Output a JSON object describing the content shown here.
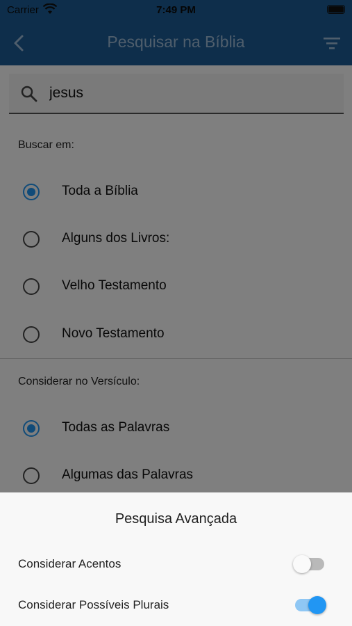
{
  "status_bar": {
    "carrier": "Carrier",
    "time": "7:49 PM"
  },
  "app_bar": {
    "title": "Pesquisar na Bíblia",
    "back_icon": "chevron-left-icon",
    "filter_icon": "filter-icon"
  },
  "search": {
    "value": "jesus",
    "icon": "search-icon"
  },
  "scope": {
    "label": "Buscar em:",
    "options": [
      {
        "label": "Toda a Bíblia",
        "selected": true
      },
      {
        "label": "Alguns dos Livros:",
        "selected": false
      },
      {
        "label": "Velho Testamento",
        "selected": false
      },
      {
        "label": "Novo Testamento",
        "selected": false
      }
    ]
  },
  "verse": {
    "label": "Considerar no Versículo:",
    "options": [
      {
        "label": "Todas as Palavras",
        "selected": true
      },
      {
        "label": "Algumas das Palavras",
        "selected": false
      }
    ]
  },
  "advanced_sheet": {
    "title": "Pesquisa Avançada",
    "toggles": [
      {
        "label": "Considerar Acentos",
        "on": false
      },
      {
        "label": "Considerar Possíveis Plurais",
        "on": true
      }
    ]
  },
  "colors": {
    "primary": "#1c5d96",
    "accent": "#2196f3"
  }
}
